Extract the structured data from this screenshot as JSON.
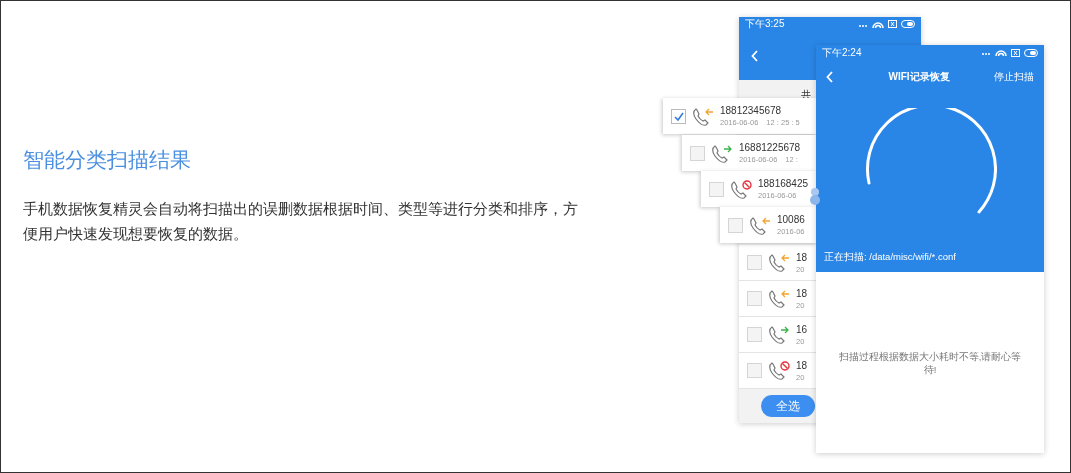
{
  "intro": {
    "title": "智能分类扫描结果",
    "description": "手机数据恢复精灵会自动将扫描出的误删数据根据时间、类型等进行分类和排序，方便用户快速发现想要恢复的数据。"
  },
  "back_phone": {
    "status_time": "下午3:25",
    "summary": "共",
    "floating_records": [
      {
        "kind": "incoming",
        "checked": true,
        "number": "18812345678",
        "date": "2016-06-06　12 : 25 : 5"
      },
      {
        "kind": "outgoing",
        "checked": false,
        "number": "16881225678",
        "date": "2016-06-06　12 :"
      },
      {
        "kind": "blocked",
        "checked": false,
        "number": "188168425",
        "date": "2016-06-06"
      },
      {
        "kind": "incoming",
        "checked": false,
        "number": "10086",
        "date": "2016-06"
      }
    ],
    "list_records": [
      {
        "kind": "incoming",
        "checked": false,
        "number": "18",
        "date": "20"
      },
      {
        "kind": "incoming",
        "checked": false,
        "number": "18",
        "date": "20"
      },
      {
        "kind": "outgoing",
        "checked": false,
        "number": "16",
        "date": "20"
      },
      {
        "kind": "blocked",
        "checked": false,
        "number": "18",
        "date": "20"
      }
    ],
    "select_all_button": "全选"
  },
  "front_phone": {
    "status_time": "下午2:24",
    "title": "WIFI记录恢复",
    "action": "停止扫描",
    "scanning_path": "正在扫描: /data/misc/wifi/*.conf",
    "message": "扫描过程根据数据大小耗时不等,请耐心等待!"
  }
}
